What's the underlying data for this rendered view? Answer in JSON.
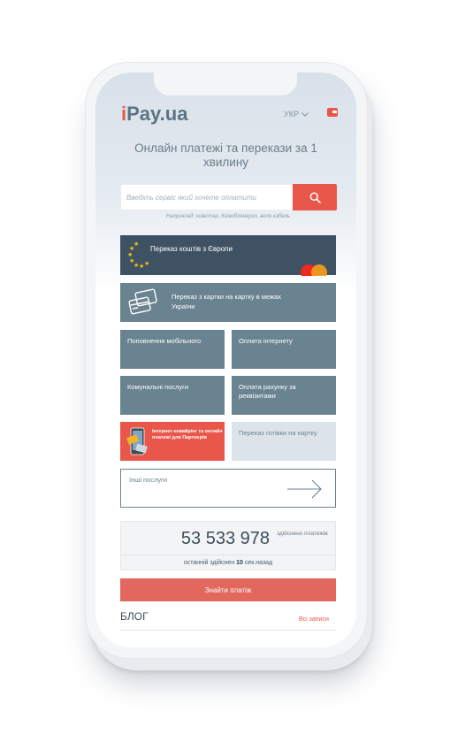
{
  "header": {
    "logo_i": "i",
    "logo_pay": "Pay.",
    "logo_ua": "ua",
    "language": "УКР",
    "language_icon": "chevron-down-icon",
    "wallet_icon": "wallet-icon"
  },
  "hero": {
    "headline": "Онлайн платежі та перекази за 1 хвилину"
  },
  "search": {
    "placeholder": "Введіть сервіс який хочете оплатити",
    "value": "",
    "hint": "Наприклад: київстар, Київобленерго, воля кабель",
    "button_icon": "search-icon"
  },
  "services": {
    "europe_transfer": "Переказ коштів з Європи",
    "card_to_card": "Переказ з картки на картку в межах України",
    "mobile_topup": "Поповнення мобільного",
    "internet_payment": "Оплата інтернету",
    "utilities": "Комунальні послуги",
    "invoice_payment": "Оплата рахунку за реквізитами",
    "partners": "Інтернет-еквайрінг та онлайн платежі для Партнерів",
    "cash_to_card": "Переказ готівки на картку",
    "other_services": "Інші послуги"
  },
  "stats": {
    "count": "53 533 978",
    "count_label": "здійснено платежів",
    "last_prefix": "останній здійснен",
    "last_value": "10",
    "last_suffix": "сек.назад"
  },
  "actions": {
    "find_payment": "Знайти платіж"
  },
  "blog": {
    "title": "БЛОГ",
    "all_posts": "Всі записи"
  },
  "colors": {
    "accent": "#e8574a",
    "tile": "#6a8391",
    "dark_tile": "#3f5264",
    "light_tile": "#dde4e9"
  }
}
